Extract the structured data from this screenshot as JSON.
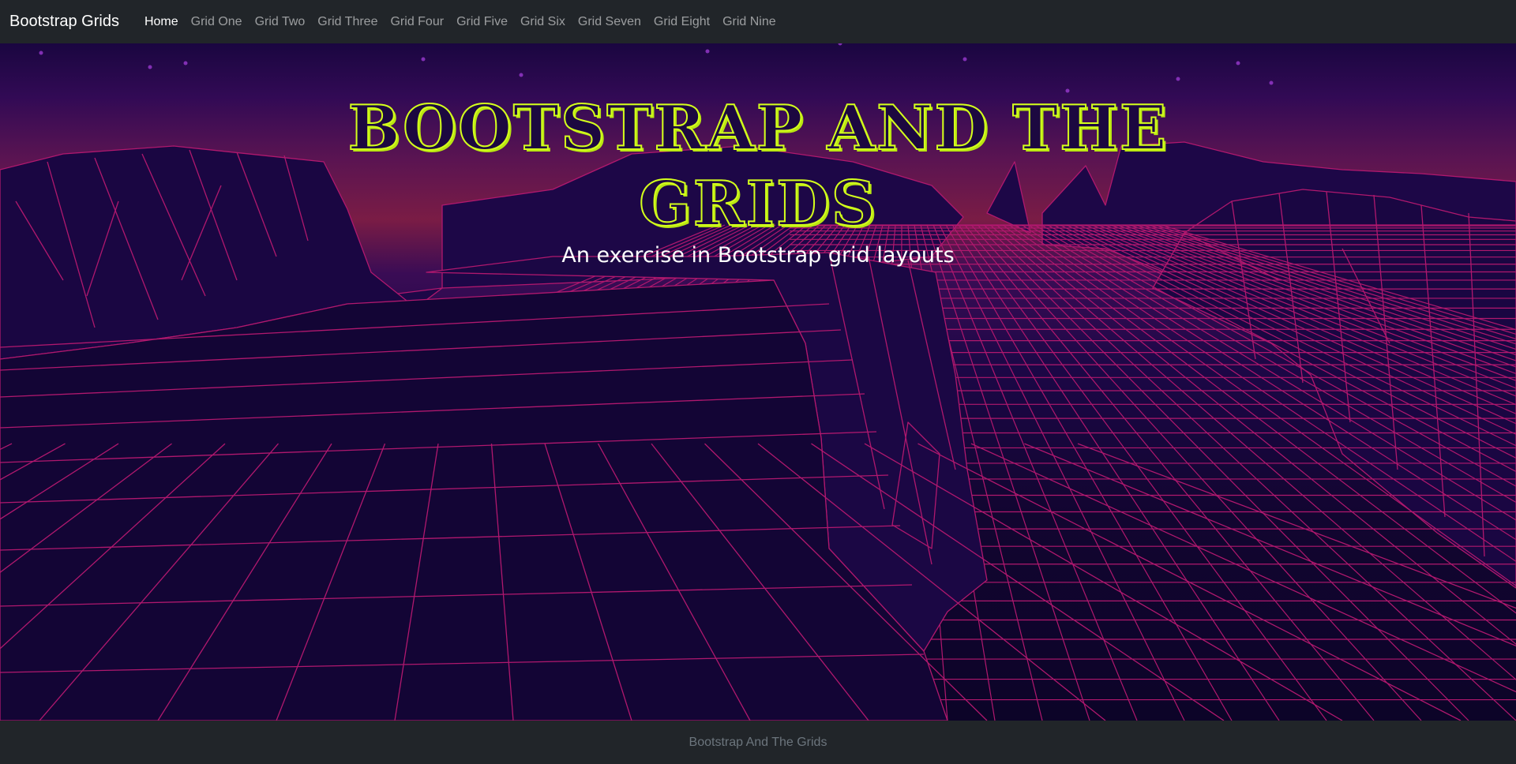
{
  "navbar": {
    "brand": "Bootstrap Grids",
    "links": [
      {
        "label": "Home",
        "active": true
      },
      {
        "label": "Grid One",
        "active": false
      },
      {
        "label": "Grid Two",
        "active": false
      },
      {
        "label": "Grid Three",
        "active": false
      },
      {
        "label": "Grid Four",
        "active": false
      },
      {
        "label": "Grid Five",
        "active": false
      },
      {
        "label": "Grid Six",
        "active": false
      },
      {
        "label": "Grid Seven",
        "active": false
      },
      {
        "label": "Grid Eight",
        "active": false
      },
      {
        "label": "Grid Nine",
        "active": false
      }
    ]
  },
  "hero": {
    "title_line1": "BOOTSTRAP AND THE",
    "title_line2": "GRIDS",
    "subtitle": "An exercise in Bootstrap grid layouts"
  },
  "footer": {
    "text": "Bootstrap And The Grids"
  },
  "colors": {
    "navbar_bg": "#212529",
    "title_outline": "#d4ff1c",
    "grid_line": "#b0186e",
    "footer_text": "#6c757d"
  }
}
